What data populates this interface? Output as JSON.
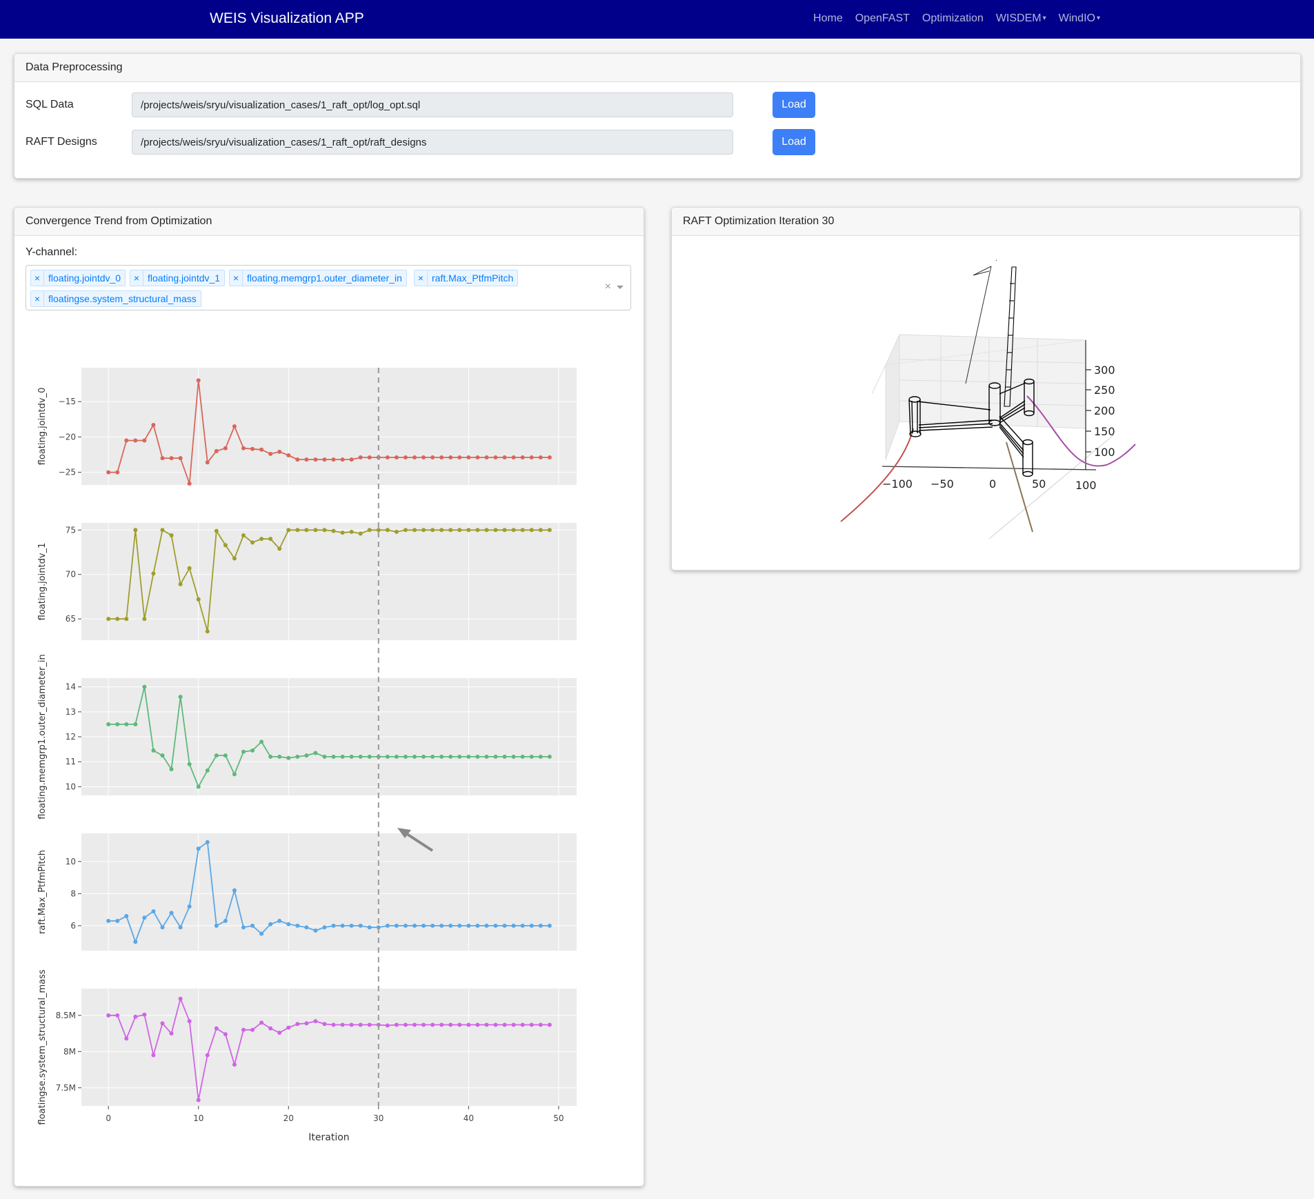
{
  "navbar": {
    "brand": "WEIS Visualization APP",
    "links": [
      {
        "label": "Home"
      },
      {
        "label": "OpenFAST"
      },
      {
        "label": "Optimization"
      },
      {
        "label": "WISDEM",
        "dropdown": true
      },
      {
        "label": "WindIO",
        "dropdown": true
      }
    ]
  },
  "preprocessing": {
    "title": "Data Preprocessing",
    "sql_label": "SQL Data",
    "sql_path": "/projects/weis/sryu/visualization_cases/1_raft_opt/log_opt.sql",
    "sql_button": "Load",
    "raft_label": "RAFT Designs",
    "raft_path": "/projects/weis/sryu/visualization_cases/1_raft_opt/raft_designs",
    "raft_button": "Load"
  },
  "convergence": {
    "title": "Convergence Trend from Optimization",
    "ychannel_label": "Y-channel:",
    "selected": [
      "floating.jointdv_0",
      "floating.jointdv_1",
      "floating.memgrp1.outer_diameter_in",
      "raft.Max_PtfmPitch",
      "floatingse.system_structural_mass"
    ],
    "clear_symbol": "×",
    "remove_symbol": "×"
  },
  "raft_view": {
    "title": "RAFT Optimization Iteration 30",
    "x_ticks": [
      "−100",
      "−50",
      "0",
      "50",
      "100"
    ],
    "z_ticks": [
      "300",
      "250",
      "200",
      "150",
      "100"
    ]
  },
  "chart_data": {
    "type": "line",
    "xlabel": "Iteration",
    "xlim": [
      -3,
      52
    ],
    "x_ticks": [
      0,
      10,
      20,
      30,
      40,
      50
    ],
    "highlight_iteration": 30,
    "grid": true,
    "x": [
      0,
      1,
      2,
      3,
      4,
      5,
      6,
      7,
      8,
      9,
      10,
      11,
      12,
      13,
      14,
      15,
      16,
      17,
      18,
      19,
      20,
      21,
      22,
      23,
      24,
      25,
      26,
      27,
      28,
      29,
      30,
      31,
      32,
      33,
      34,
      35,
      36,
      37,
      38,
      39,
      40,
      41,
      42,
      43,
      44,
      45,
      46,
      47,
      48,
      49
    ],
    "series": [
      {
        "name": "floating.jointdv_0",
        "color": "#d9665a",
        "ylim": [
          -26.8,
          -10.2
        ],
        "ticks": [
          -15,
          -20,
          -25
        ],
        "tick_labels": [
          "−15",
          "−20",
          "−25"
        ],
        "values": [
          -25.0,
          -25.0,
          -20.5,
          -20.5,
          -20.5,
          -18.3,
          -23.0,
          -23.0,
          -23.0,
          -26.6,
          -12.0,
          -23.6,
          -22.0,
          -21.6,
          -18.5,
          -21.6,
          -21.7,
          -21.8,
          -22.4,
          -22.1,
          -22.6,
          -23.2,
          -23.2,
          -23.2,
          -23.2,
          -23.2,
          -23.2,
          -23.2,
          -22.9,
          -22.9,
          -22.9,
          -22.9,
          -22.9,
          -22.9,
          -22.9,
          -22.9,
          -22.9,
          -22.9,
          -22.9,
          -22.9,
          -22.9,
          -22.9,
          -22.9,
          -22.9,
          -22.9,
          -22.9,
          -22.9,
          -22.9,
          -22.9,
          -22.9
        ]
      },
      {
        "name": "floating.jointdv_1",
        "color": "#9e9e2c",
        "ylim": [
          62.6,
          75.8
        ],
        "ticks": [
          75,
          70,
          65
        ],
        "tick_labels": [
          "75",
          "70",
          "65"
        ],
        "values": [
          65.0,
          65.0,
          65.0,
          75.0,
          65.0,
          70.1,
          75.0,
          74.4,
          68.9,
          70.7,
          67.2,
          63.6,
          74.9,
          73.3,
          71.8,
          74.4,
          73.6,
          74.0,
          74.0,
          72.9,
          75.0,
          75.0,
          75.0,
          75.0,
          75.0,
          74.9,
          74.7,
          74.8,
          74.6,
          75.0,
          75.0,
          75.0,
          74.8,
          75.0,
          75.0,
          75.0,
          75.0,
          75.0,
          75.0,
          75.0,
          75.0,
          75.0,
          75.0,
          75.0,
          75.0,
          75.0,
          75.0,
          75.0,
          75.0,
          75.0
        ]
      },
      {
        "name": "floating.memgrp1.outer_diameter_in",
        "color": "#5db97a",
        "ylim": [
          9.65,
          14.35
        ],
        "ticks": [
          14,
          13,
          12,
          11,
          10
        ],
        "tick_labels": [
          "14",
          "13",
          "12",
          "11",
          "10"
        ],
        "values": [
          12.5,
          12.5,
          12.5,
          12.5,
          14.0,
          11.45,
          11.25,
          10.7,
          13.6,
          10.9,
          10.0,
          10.65,
          11.25,
          11.25,
          10.5,
          11.4,
          11.45,
          11.8,
          11.2,
          11.2,
          11.15,
          11.2,
          11.25,
          11.35,
          11.2,
          11.2,
          11.2,
          11.2,
          11.2,
          11.2,
          11.2,
          11.2,
          11.2,
          11.2,
          11.2,
          11.2,
          11.2,
          11.2,
          11.2,
          11.2,
          11.2,
          11.2,
          11.2,
          11.2,
          11.2,
          11.2,
          11.2,
          11.2,
          11.2,
          11.2
        ]
      },
      {
        "name": "raft.Max_PtfmPitch",
        "color": "#5aa7e6",
        "ylim": [
          4.45,
          11.75
        ],
        "ticks": [
          10,
          8,
          6
        ],
        "tick_labels": [
          "10",
          "8",
          "6"
        ],
        "values": [
          6.3,
          6.3,
          6.6,
          5.0,
          6.5,
          6.9,
          5.9,
          6.8,
          5.9,
          7.2,
          10.8,
          11.2,
          6.0,
          6.3,
          8.2,
          5.9,
          6.0,
          5.5,
          6.1,
          6.3,
          6.1,
          6.0,
          5.9,
          5.7,
          5.9,
          6.0,
          6.0,
          6.0,
          6.0,
          5.9,
          5.9,
          6.0,
          6.0,
          6.0,
          6.0,
          6.0,
          6.0,
          6.0,
          6.0,
          6.0,
          6.0,
          6.0,
          6.0,
          6.0,
          6.0,
          6.0,
          6.0,
          6.0,
          6.0,
          6.0
        ]
      },
      {
        "name": "floatingse.system_structural_mass",
        "color": "#cf64e6",
        "ylim": [
          7250000,
          8870000
        ],
        "ticks": [
          8500000,
          8000000,
          7500000
        ],
        "tick_labels": [
          "8.5M",
          "8M",
          "7.5M"
        ],
        "values": [
          8500000,
          8500000,
          8180000,
          8480000,
          8510000,
          7950000,
          8390000,
          8250000,
          8730000,
          8420000,
          7330000,
          7950000,
          8320000,
          8240000,
          7820000,
          8300000,
          8300000,
          8400000,
          8320000,
          8260000,
          8330000,
          8380000,
          8390000,
          8420000,
          8380000,
          8370000,
          8370000,
          8370000,
          8370000,
          8370000,
          8370000,
          8360000,
          8370000,
          8370000,
          8370000,
          8370000,
          8370000,
          8370000,
          8370000,
          8370000,
          8370000,
          8370000,
          8370000,
          8370000,
          8370000,
          8370000,
          8370000,
          8370000,
          8370000,
          8370000
        ]
      }
    ]
  }
}
